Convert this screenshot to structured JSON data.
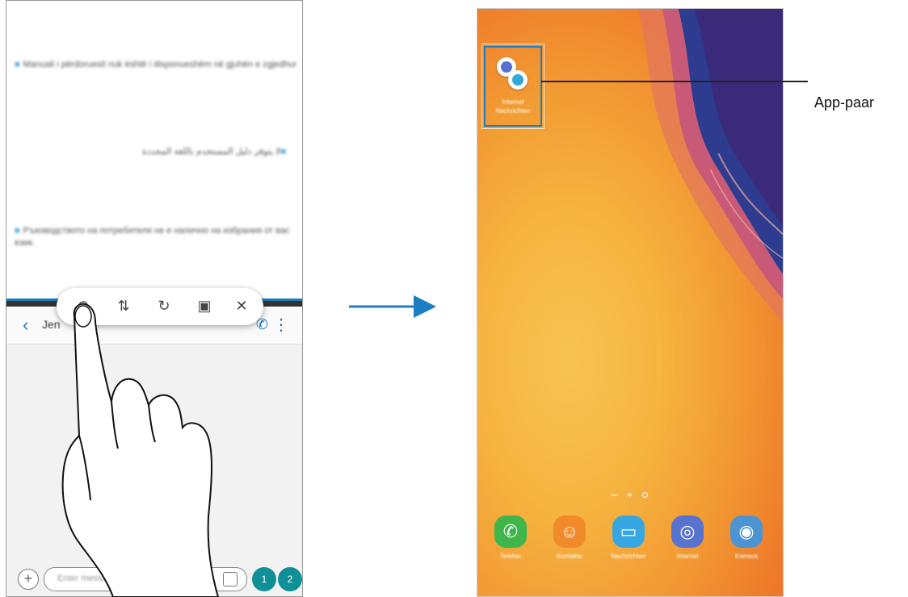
{
  "left_phone": {
    "messages": [
      "Manuali i përdoruesit nuk është i disponueshëm në gjuhën e zgjedhur",
      "لا يتوفر دليل المستخدم باللغة المحددة",
      "Ръководството на потребителя не е налично на избрания от вас език."
    ],
    "chat_header": {
      "back_icon": "‹",
      "contact_name": "Jen",
      "phone_icon": "✆",
      "more_icon": "⋮"
    },
    "toolbar": {
      "pair_icon": "⊕",
      "swap_icon": "⇅",
      "rotate_icon": "↻",
      "window_icon": "▣",
      "close_icon": "✕"
    },
    "input": {
      "add_icon": "+",
      "placeholder": "Enter message"
    },
    "send_buttons": [
      "1",
      "2"
    ]
  },
  "right_phone": {
    "app_pair_label": "Internet Nachrichten",
    "dock_apps": [
      {
        "label": "Telefon",
        "icon": "✆"
      },
      {
        "label": "Kontakte",
        "icon": "☺"
      },
      {
        "label": "Nachrichten",
        "icon": "▭"
      },
      {
        "label": "Internet",
        "icon": "◎"
      },
      {
        "label": "Kamera",
        "icon": "◉"
      }
    ]
  },
  "callout": {
    "label": "App-paar"
  },
  "colors": {
    "accent": "#1b7ec2",
    "send": "#0f8f96"
  }
}
